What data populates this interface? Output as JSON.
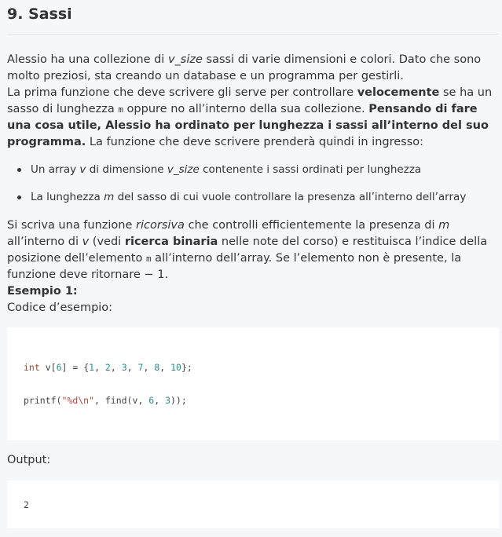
{
  "title": "9. Sassi",
  "intro": {
    "p1_a": "Alessio ha una collezione di ",
    "p1_var": "v_size",
    "p1_b": " sassi di varie dimensioni e colori. Dato che sono molto preziosi, sta creando un database e un programma per gestirli.",
    "p2_a": "La prima funzione che deve scrivere gli serve per controllare ",
    "p2_bold": "velocemente",
    "p2_b": " se ha un sasso di lunghezza ",
    "p2_code": "m",
    "p2_c": " oppure no all’interno della sua collezione. ",
    "p2_bold2": "Pensando di fare una cosa utile, Alessio ha ordinato per lunghezza i sassi all’interno del suo programma.",
    "p2_d": " La funzione che deve scrivere prenderà quindi in ingresso:"
  },
  "bullets": [
    {
      "a": "Un array ",
      "v": "v",
      "b": " di dimensione ",
      "v2": "v_size",
      "c": " contenente i sassi ordinati per lunghezza"
    },
    {
      "a": "La lunghezza ",
      "v": "m",
      "b": " del sasso di cui vuole controllare la presenza all’interno dell’array"
    }
  ],
  "desc": {
    "a": "Si scriva una funzione ",
    "ric": "ricorsiva",
    "b": " che controlli efficientemente la presenza di ",
    "m": "m",
    "c": " all’interno di ",
    "v": "v",
    "d": " (vedi ",
    "bold": "ricerca binaria",
    "e": " nelle note del corso) e restituisca l’indice della posizione dell’elemento ",
    "code": "m",
    "f": " all’interno dell’array. Se l’elemento non è presente, la funzione deve ritornare ",
    "ret": "− 1",
    "g": ".",
    "example": "Esempio 1:",
    "example_code_label": "Codice d’esempio:"
  },
  "code": {
    "line1": {
      "kw": "int",
      "a": " v[",
      "n1": "6",
      "b": "] = {",
      "vals": [
        "1",
        "2",
        "3",
        "7",
        "8",
        "10"
      ],
      "c": "};"
    },
    "line2": {
      "a": "printf(",
      "s": "\"%d\\n\"",
      "b": ", find(v, ",
      "n1": "6",
      "c": ", ",
      "n2": "3",
      "d": "));"
    }
  },
  "output_label": "Output:",
  "output_value": "2"
}
